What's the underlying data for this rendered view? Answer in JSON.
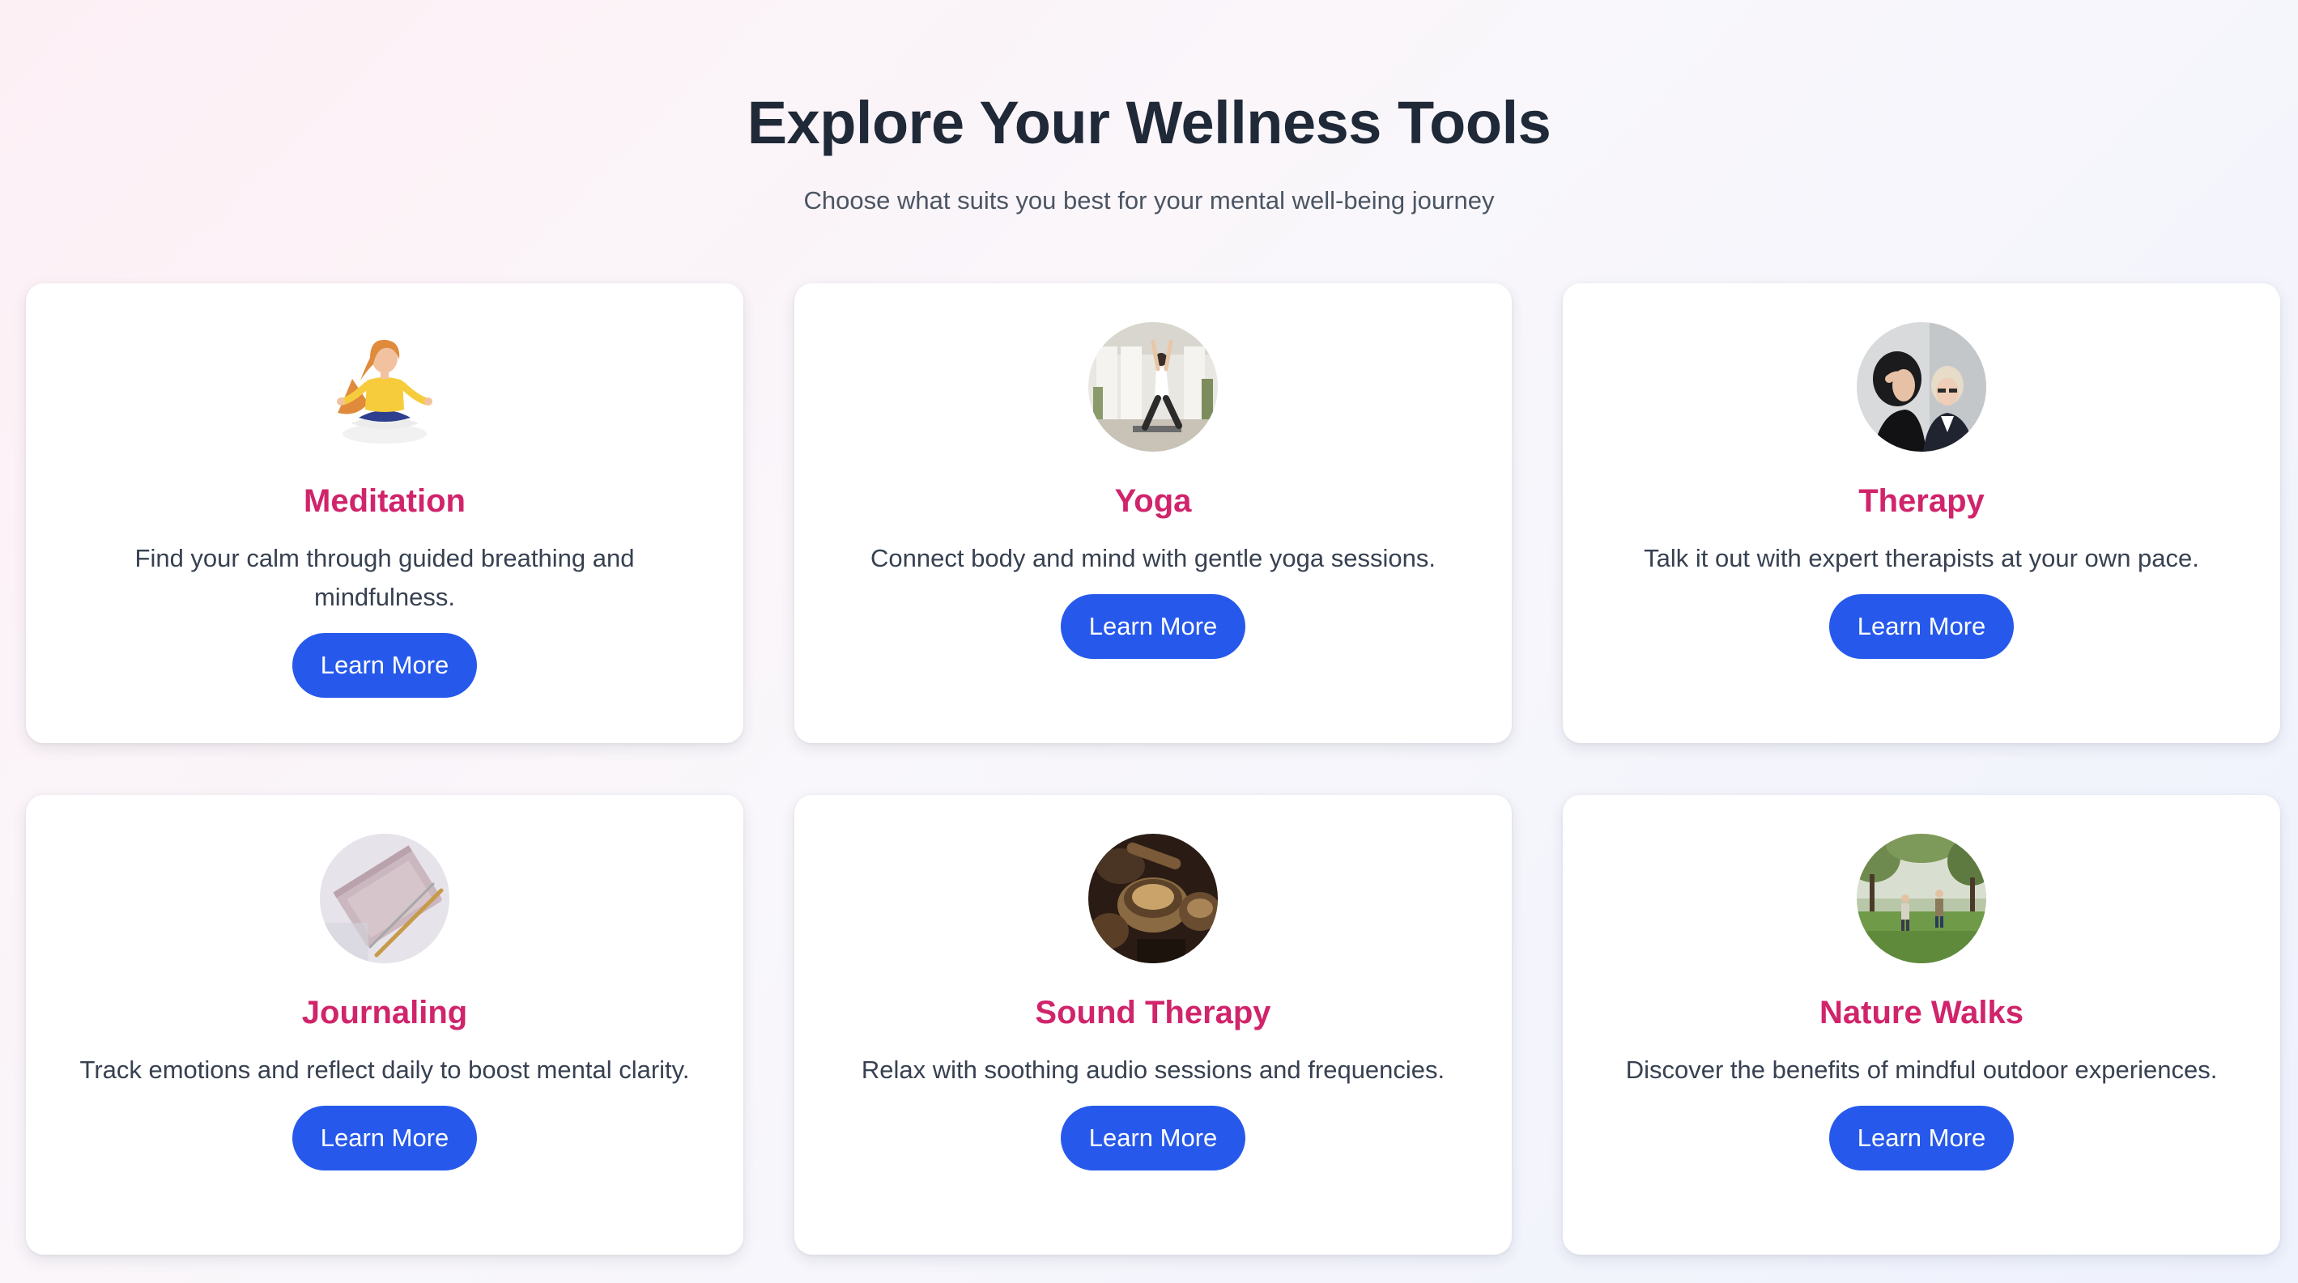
{
  "header": {
    "title": "Explore Your Wellness Tools",
    "subtitle": "Choose what suits you best for your mental well-being journey"
  },
  "colors": {
    "accent_title": "#d0246b",
    "button": "#2659eb",
    "heading": "#1f2937"
  },
  "cards": [
    {
      "title": "Meditation",
      "description": "Find your calm through guided breathing and mindfulness.",
      "button_label": "Learn More",
      "image": "meditation-illustration"
    },
    {
      "title": "Yoga",
      "description": "Connect body and mind with gentle yoga sessions.",
      "button_label": "Learn More",
      "image": "yoga-photo"
    },
    {
      "title": "Therapy",
      "description": "Talk it out with expert therapists at your own pace.",
      "button_label": "Learn More",
      "image": "therapy-photo"
    },
    {
      "title": "Journaling",
      "description": "Track emotions and reflect daily to boost mental clarity.",
      "button_label": "Learn More",
      "image": "journal-photo"
    },
    {
      "title": "Sound Therapy",
      "description": "Relax with soothing audio sessions and frequencies.",
      "button_label": "Learn More",
      "image": "singing-bowl-photo"
    },
    {
      "title": "Nature Walks",
      "description": "Discover the benefits of mindful outdoor experiences.",
      "button_label": "Learn More",
      "image": "nature-walk-photo"
    }
  ]
}
